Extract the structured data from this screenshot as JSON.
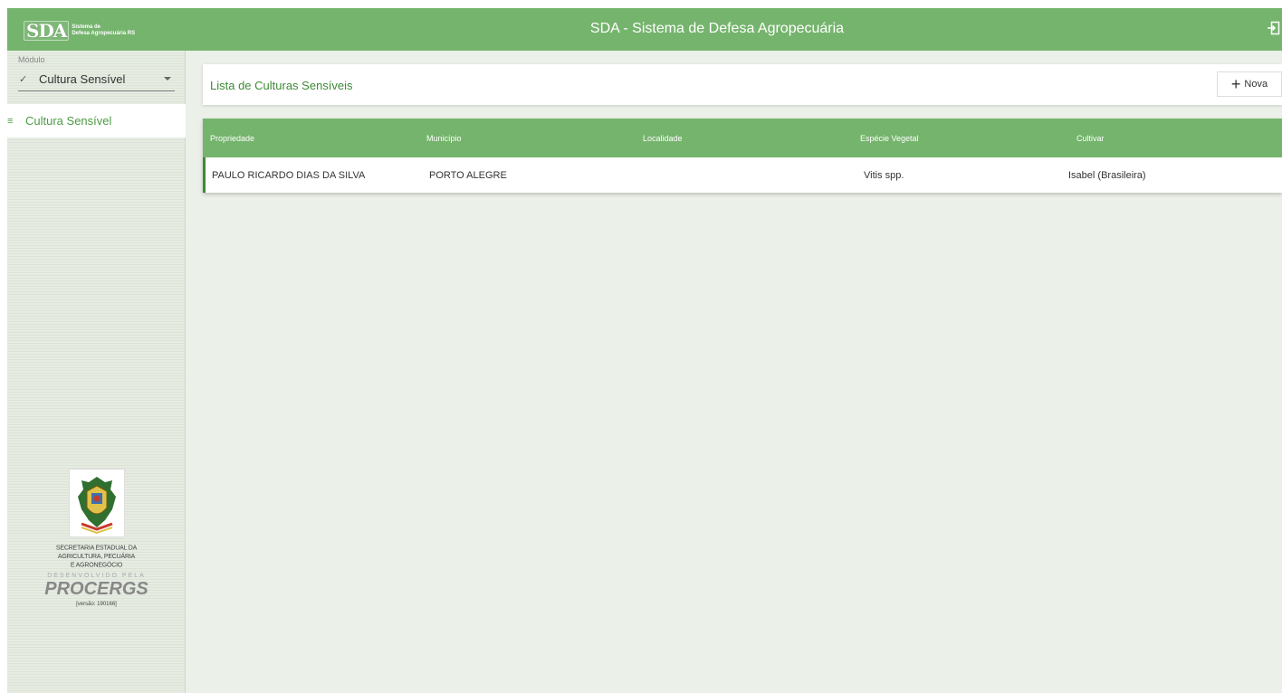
{
  "header": {
    "logo_mark": "SDA",
    "logo_line1": "Sistema de",
    "logo_line2": "Defesa Agropecuária RS",
    "title": "SDA - Sistema de Defesa Agropecuária",
    "logout_icon": "logout-icon"
  },
  "sidebar": {
    "module_label": "Módulo",
    "module_value": "Cultura Sensível",
    "nav_items": [
      {
        "label": "Cultura Sensível",
        "icon": "list-icon"
      }
    ],
    "footer": {
      "secretaria_line1": "SECRETARIA ESTADUAL DA",
      "secretaria_line2": "AGRICULTURA, PECUÁRIA",
      "secretaria_line3": "E AGRONEGÓCIO",
      "developed_by": "DESENVOLVIDO PELA",
      "developer": "PROCERGS",
      "version": "[versão: 190166]"
    }
  },
  "main": {
    "list_title": "Lista de Culturas Sensíveis",
    "new_button": "Nova",
    "table": {
      "columns": [
        "Propriedade",
        "Município",
        "Localidade",
        "Espécie Vegetal",
        "Cultivar"
      ],
      "rows": [
        [
          "PAULO RICARDO DIAS DA SILVA",
          "PORTO ALEGRE",
          "",
          "Vitis spp.",
          "Isabel (Brasileira)"
        ]
      ]
    }
  },
  "colors": {
    "primary": "#75b46d",
    "primary_dark": "#3d8a36",
    "background": "#ebf0e8"
  }
}
